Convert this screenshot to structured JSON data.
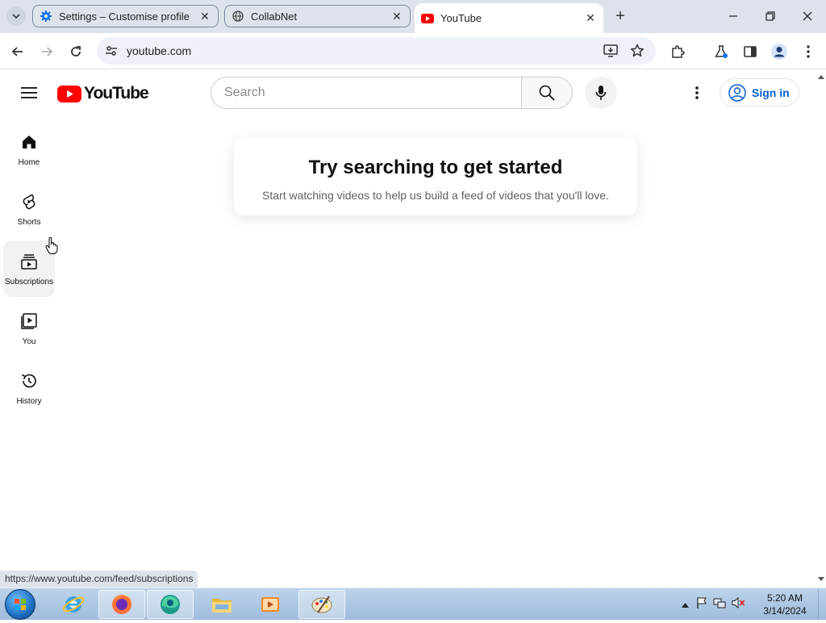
{
  "browser": {
    "tabs": [
      {
        "title": "Settings – Customise profile",
        "favicon": "gear-icon"
      },
      {
        "title": "CollabNet",
        "favicon": "globe-icon"
      },
      {
        "title": "YouTube",
        "favicon": "youtube-icon",
        "active": true
      }
    ],
    "address": "youtube.com",
    "status_url": "https://www.youtube.com/feed/subscriptions"
  },
  "youtube": {
    "logo_text": "YouTube",
    "search_placeholder": "Search",
    "sign_in_label": "Sign in",
    "guide": [
      {
        "label": "Home",
        "icon": "home-icon"
      },
      {
        "label": "Shorts",
        "icon": "shorts-icon"
      },
      {
        "label": "Subscriptions",
        "icon": "subscriptions-icon"
      },
      {
        "label": "You",
        "icon": "you-icon"
      },
      {
        "label": "History",
        "icon": "history-icon"
      }
    ],
    "prompt": {
      "title": "Try searching to get started",
      "subtitle": "Start watching videos to help us build a feed of videos that you'll love."
    }
  },
  "taskbar": {
    "time": "5:20 AM",
    "date": "3/14/2024"
  },
  "colors": {
    "youtube_red": "#ff0000",
    "link_blue": "#065fd4",
    "tabstrip": "#dee3eb"
  }
}
